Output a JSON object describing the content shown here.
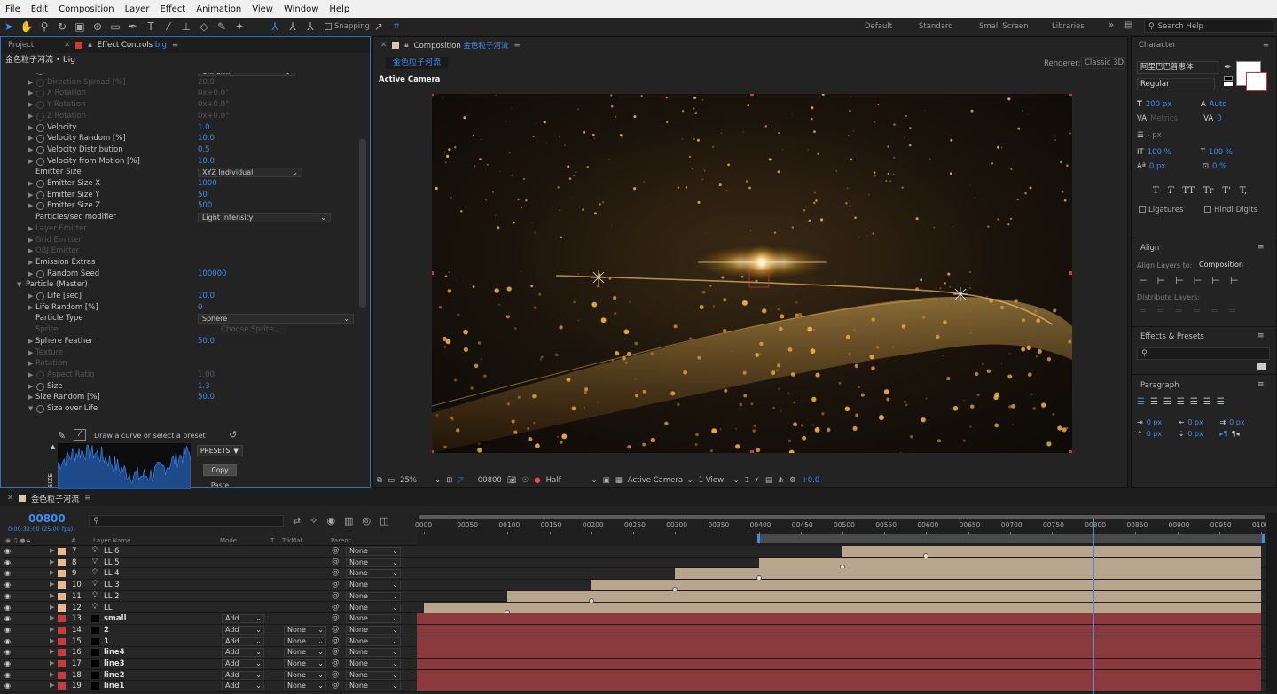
{
  "menu": [
    "File",
    "Edit",
    "Composition",
    "Layer",
    "Effect",
    "Animation",
    "View",
    "Window",
    "Help"
  ],
  "toolbar": {
    "snapping": "Snapping"
  },
  "workspaces": [
    "Default",
    "Standard",
    "Small Screen",
    "Libraries"
  ],
  "search_help": "Search Help",
  "effect_panel": {
    "tab_project": "Project",
    "tab_effect": "Effect Controls",
    "tab_effect_layer": "big",
    "breadcrumb": "金色粒子河流 • big",
    "rows": [
      {
        "label": "Direction",
        "value": "Uniform",
        "type": "dd",
        "indent": 2,
        "stop": true,
        "dim": false
      },
      {
        "label": "Direction Spread [%]",
        "value": "20.0",
        "type": "val",
        "indent": 2,
        "stop": true,
        "dim": true,
        "tri": true
      },
      {
        "label": "X Rotation",
        "value": "0x+0.0°",
        "type": "val",
        "indent": 2,
        "stop": true,
        "dim": true,
        "tri": true
      },
      {
        "label": "Y Rotation",
        "value": "0x+0.0°",
        "type": "val",
        "indent": 2,
        "stop": true,
        "dim": true,
        "tri": true
      },
      {
        "label": "Z Rotation",
        "value": "0x+0.0°",
        "type": "val",
        "indent": 2,
        "stop": true,
        "dim": true,
        "tri": true
      },
      {
        "label": "Velocity",
        "value": "1.0",
        "type": "val",
        "indent": 2,
        "stop": true,
        "dim": false,
        "tri": true
      },
      {
        "label": "Velocity Random [%]",
        "value": "10.0",
        "type": "val",
        "indent": 2,
        "stop": true,
        "dim": false,
        "tri": true
      },
      {
        "label": "Velocity Distribution",
        "value": "0.5",
        "type": "val",
        "indent": 2,
        "stop": true,
        "dim": false,
        "tri": true
      },
      {
        "label": "Velocity from Motion [%]",
        "value": "10.0",
        "type": "val",
        "indent": 2,
        "stop": true,
        "dim": false,
        "tri": true
      },
      {
        "label": "Emitter Size",
        "value": "XYZ Individual",
        "type": "dd",
        "indent": 2,
        "stop": false,
        "dim": false
      },
      {
        "label": "Emitter Size X",
        "value": "1000",
        "type": "val",
        "indent": 2,
        "stop": true,
        "dim": false,
        "tri": true
      },
      {
        "label": "Emitter Size Y",
        "value": "50",
        "type": "val",
        "indent": 2,
        "stop": true,
        "dim": false,
        "tri": true
      },
      {
        "label": "Emitter Size Z",
        "value": "500",
        "type": "val",
        "indent": 2,
        "stop": true,
        "dim": false,
        "tri": true
      },
      {
        "label": "Particles/sec modifier",
        "value": "Light Intensity",
        "type": "dd",
        "indent": 2,
        "stop": false,
        "dim": false
      },
      {
        "label": "Layer Emitter",
        "value": "",
        "type": "val",
        "indent": 2,
        "stop": false,
        "dim": true,
        "tri": true
      },
      {
        "label": "Grid Emitter",
        "value": "",
        "type": "val",
        "indent": 2,
        "stop": false,
        "dim": true,
        "tri": true
      },
      {
        "label": "OBJ Emitter",
        "value": "",
        "type": "val",
        "indent": 2,
        "stop": false,
        "dim": true,
        "tri": true
      },
      {
        "label": "Emission Extras",
        "value": "",
        "type": "val",
        "indent": 2,
        "stop": false,
        "dim": false,
        "tri": true
      },
      {
        "label": "Random Seed",
        "value": "100000",
        "type": "val",
        "indent": 2,
        "stop": true,
        "dim": false,
        "tri": true
      },
      {
        "label": "Particle (Master)",
        "value": "",
        "type": "val",
        "indent": 1,
        "stop": false,
        "dim": false,
        "open": true
      },
      {
        "label": "Life [sec]",
        "value": "10.0",
        "type": "val",
        "indent": 2,
        "stop": true,
        "dim": false,
        "tri": true
      },
      {
        "label": "Life Random [%]",
        "value": "0",
        "type": "val",
        "indent": 2,
        "stop": false,
        "dim": false,
        "tri": true
      },
      {
        "label": "Particle Type",
        "value": "Sphere",
        "type": "dd",
        "indent": 2,
        "stop": false,
        "dim": false
      },
      {
        "label": "Sprite",
        "value": "Choose Sprite...",
        "type": "val",
        "indent": 2,
        "stop": false,
        "dim": true
      },
      {
        "label": "Sphere Feather",
        "value": "50.0",
        "type": "val",
        "indent": 2,
        "stop": false,
        "dim": false,
        "tri": true
      },
      {
        "label": "Texture",
        "value": "",
        "type": "val",
        "indent": 2,
        "stop": false,
        "dim": true,
        "tri": true
      },
      {
        "label": "Rotation",
        "value": "",
        "type": "val",
        "indent": 2,
        "stop": false,
        "dim": true,
        "tri": true
      },
      {
        "label": "Aspect Ratio",
        "value": "1.00",
        "type": "val",
        "indent": 2,
        "stop": true,
        "dim": true,
        "tri": true
      },
      {
        "label": "Size",
        "value": "1.3",
        "type": "val",
        "indent": 2,
        "stop": true,
        "dim": false,
        "tri": true
      },
      {
        "label": "Size Random [%]",
        "value": "50.0",
        "type": "val",
        "indent": 2,
        "stop": false,
        "dim": false,
        "tri": true
      },
      {
        "label": "Size over Life",
        "value": "",
        "type": "val",
        "indent": 2,
        "stop": true,
        "dim": false,
        "open": true
      }
    ],
    "curve_hint": "Draw a curve or select a preset",
    "presets": "PRESETS",
    "copy": "Copy",
    "paste": "Paste",
    "size_axis": "SIZE"
  },
  "composition": {
    "tab_prefix": "Composition",
    "name": "金色粒子河流",
    "renderer_label": "Renderer:",
    "renderer": "Classic 3D",
    "active_camera": "Active Camera",
    "zoom": "25%",
    "timecode": "00800",
    "resolution": "Half",
    "view_camera": "Active Camera",
    "views": "1 View",
    "exposure": "+0.0"
  },
  "character": {
    "title": "Character",
    "font": "阿里巴巴普惠体",
    "style": "Regular",
    "size": "200 px",
    "leading": "Auto",
    "kerning": "Metrics",
    "tracking": "0",
    "stroke_width": "- px",
    "vscale": "100 %",
    "hscale": "100 %",
    "baseline": "0 px",
    "tsume": "0 %",
    "styles": [
      "T",
      "T",
      "TT",
      "Tr",
      "T'",
      "T,"
    ],
    "ligatures": "Ligatures",
    "hindi": "Hindi Digits"
  },
  "align": {
    "title": "Align",
    "align_to_label": "Align Layers to:",
    "align_to": "Composition",
    "distribute": "Distribute Layers:"
  },
  "effects_presets": {
    "title": "Effects & Presets"
  },
  "paragraph": {
    "title": "Paragraph",
    "values": [
      "0 px",
      "0 px",
      "0 px",
      "0 px",
      "0 px"
    ]
  },
  "timeline": {
    "tab": "金色粒子河流",
    "timecode": "00800",
    "timecode_sub": "0:00:32:00 (25.00 fps)",
    "headers": {
      "num": "#",
      "name": "Layer Name",
      "mode": "Mode",
      "t": "T",
      "trkmat": "TrkMat",
      "parent": "Parent"
    },
    "ruler": [
      "0000",
      "00050",
      "00100",
      "00150",
      "00200",
      "00250",
      "00300",
      "00350",
      "00400",
      "00450",
      "00500",
      "00550",
      "00600",
      "00650",
      "00700",
      "00750",
      "00800",
      "00850",
      "00900",
      "00950",
      "0100"
    ],
    "layers": [
      {
        "num": "7",
        "name": "LL 6",
        "color": "#e8b890",
        "type": "light",
        "mode": "",
        "trk": "",
        "parent": "None",
        "start": 0.5,
        "kf": 0.6
      },
      {
        "num": "8",
        "name": "LL 5",
        "color": "#e8b890",
        "type": "light",
        "mode": "",
        "trk": "",
        "parent": "None",
        "start": 0.4,
        "kf": 0.5
      },
      {
        "num": "9",
        "name": "LL 4",
        "color": "#e8b890",
        "type": "light",
        "mode": "",
        "trk": "",
        "parent": "None",
        "start": 0.3,
        "kf": 0.4
      },
      {
        "num": "10",
        "name": "LL 3",
        "color": "#e8b890",
        "type": "light",
        "mode": "",
        "trk": "",
        "parent": "None",
        "start": 0.2,
        "kf": 0.3
      },
      {
        "num": "11",
        "name": "LL 2",
        "color": "#e8b890",
        "type": "light",
        "mode": "",
        "trk": "",
        "parent": "None",
        "start": 0.1,
        "kf": 0.2
      },
      {
        "num": "12",
        "name": "LL",
        "color": "#e8b890",
        "type": "light",
        "mode": "",
        "trk": "",
        "parent": "None",
        "start": 0.0,
        "kf": 0.1
      },
      {
        "num": "13",
        "name": "small",
        "color": "#c83c3c",
        "type": "solid",
        "mode": "Add",
        "trk": "",
        "parent": "None",
        "start": 0,
        "kf": -1
      },
      {
        "num": "14",
        "name": "2",
        "color": "#c83c3c",
        "type": "solid",
        "mode": "Add",
        "trk": "None",
        "parent": "None",
        "start": 0,
        "kf": -1
      },
      {
        "num": "15",
        "name": "1",
        "color": "#c83c3c",
        "type": "solid",
        "mode": "Add",
        "trk": "None",
        "parent": "None",
        "start": 0,
        "kf": -1
      },
      {
        "num": "16",
        "name": "line4",
        "color": "#c83c3c",
        "type": "solid",
        "mode": "Add",
        "trk": "None",
        "parent": "None",
        "start": 0,
        "kf": -1
      },
      {
        "num": "17",
        "name": "line3",
        "color": "#c83c3c",
        "type": "solid",
        "mode": "Add",
        "trk": "None",
        "parent": "None",
        "start": 0,
        "kf": -1
      },
      {
        "num": "18",
        "name": "line2",
        "color": "#c83c3c",
        "type": "solid",
        "mode": "Add",
        "trk": "None",
        "parent": "None",
        "start": 0,
        "kf": -1
      },
      {
        "num": "19",
        "name": "line1",
        "color": "#c83c3c",
        "type": "solid",
        "mode": "Add",
        "trk": "None",
        "parent": "None",
        "start": 0,
        "kf": -1
      }
    ],
    "playhead": 0.8,
    "work_start": 0.4
  },
  "colors": {
    "accent": "#3b8df5",
    "light_bar": "#b8a58e",
    "solid_bar": "#8a3a3d"
  }
}
